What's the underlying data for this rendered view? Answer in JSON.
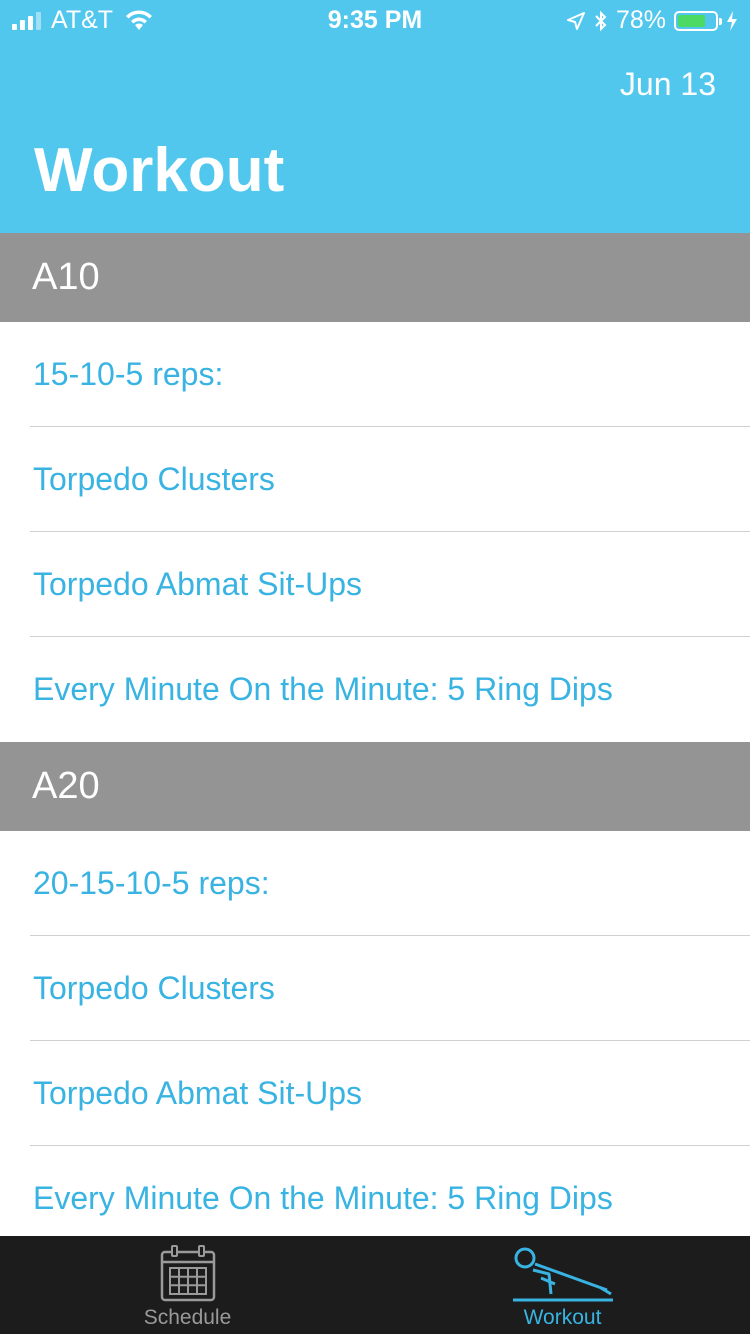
{
  "status_bar": {
    "carrier": "AT&T",
    "time": "9:35 PM",
    "battery": "78%",
    "battery_level": 0.78
  },
  "header": {
    "date": "Jun 13",
    "title": "Workout"
  },
  "sections": [
    {
      "title": "A10",
      "items": [
        "15-10-5 reps:",
        "Torpedo Clusters",
        "Torpedo Abmat Sit-Ups",
        "Every Minute On the Minute: 5 Ring Dips"
      ]
    },
    {
      "title": "A20",
      "items": [
        "20-15-10-5 reps:",
        "Torpedo Clusters",
        "Torpedo Abmat Sit-Ups",
        "Every Minute On the Minute: 5 Ring Dips"
      ]
    }
  ],
  "tab_bar": {
    "tabs": [
      {
        "label": "Schedule",
        "icon": "calendar-icon",
        "active": false
      },
      {
        "label": "Workout",
        "icon": "pushup-icon",
        "active": true
      }
    ]
  },
  "colors": {
    "header_bg": "#52C7EE",
    "section_bg": "#949494",
    "accent": "#39B3E2",
    "tab_bar_bg": "#1c1c1c"
  }
}
